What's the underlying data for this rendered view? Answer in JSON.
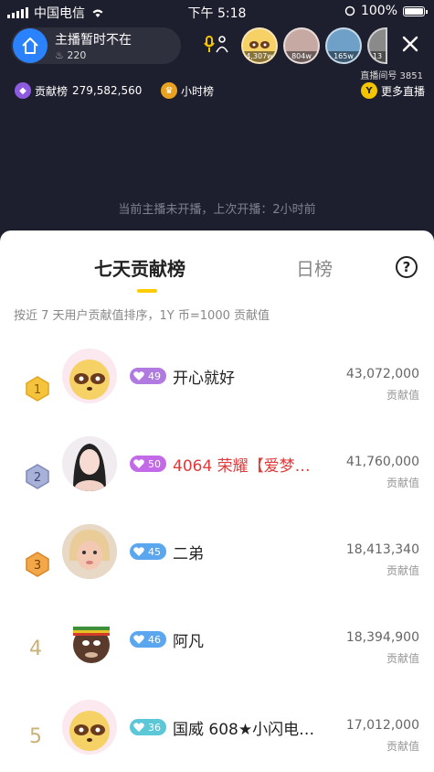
{
  "status_bar": {
    "carrier": "中国电信",
    "time": "下午 5:18",
    "battery": "100%"
  },
  "host": {
    "name": "主播暂时不在",
    "heat": "220"
  },
  "viewers": [
    {
      "count": "4,307w",
      "color": "#f3c14b"
    },
    {
      "count": "804w",
      "color": "#c7a9a4"
    },
    {
      "count": "165w",
      "color": "#6ea0c8"
    },
    {
      "count": "13",
      "color": "#8a8a8a"
    }
  ],
  "room_no": "直播间号 3851",
  "contribution": {
    "label": "贡献榜",
    "value": "279,582,560"
  },
  "hourly_label": "小时榜",
  "more_live": "更多直播",
  "notice": "当前主播未开播，上次开播：2小时前",
  "sheet": {
    "tab_week": "七天贡献榜",
    "tab_day": "日榜",
    "help": "?",
    "description": "按近 7 天用户贡献值排序，1Y 币=1000 贡献值",
    "score_label": "贡献值",
    "ranks": [
      {
        "rank": "1",
        "level": "49",
        "name": "开心就好",
        "score": "43,072,000",
        "level_color": "#b07ae0",
        "name_color": "normal",
        "avatar": "raccoon"
      },
      {
        "rank": "2",
        "level": "50",
        "name": "4064 荣耀【爱梦…",
        "score": "41,760,000",
        "level_color": "#c26ae8",
        "name_color": "red",
        "avatar": "girl"
      },
      {
        "rank": "3",
        "level": "45",
        "name": "二弟",
        "score": "18,413,340",
        "level_color": "#5aa7f0",
        "name_color": "normal",
        "avatar": "blonde"
      },
      {
        "rank": "4",
        "level": "46",
        "name": "阿凡",
        "score": "18,394,900",
        "level_color": "#5aa7f0",
        "name_color": "normal",
        "avatar": "cartoon"
      },
      {
        "rank": "5",
        "level": "36",
        "name": "国威 608★小闪电…",
        "score": "17,012,000",
        "level_color": "#5cc7d6",
        "name_color": "normal",
        "avatar": "raccoon"
      }
    ]
  }
}
